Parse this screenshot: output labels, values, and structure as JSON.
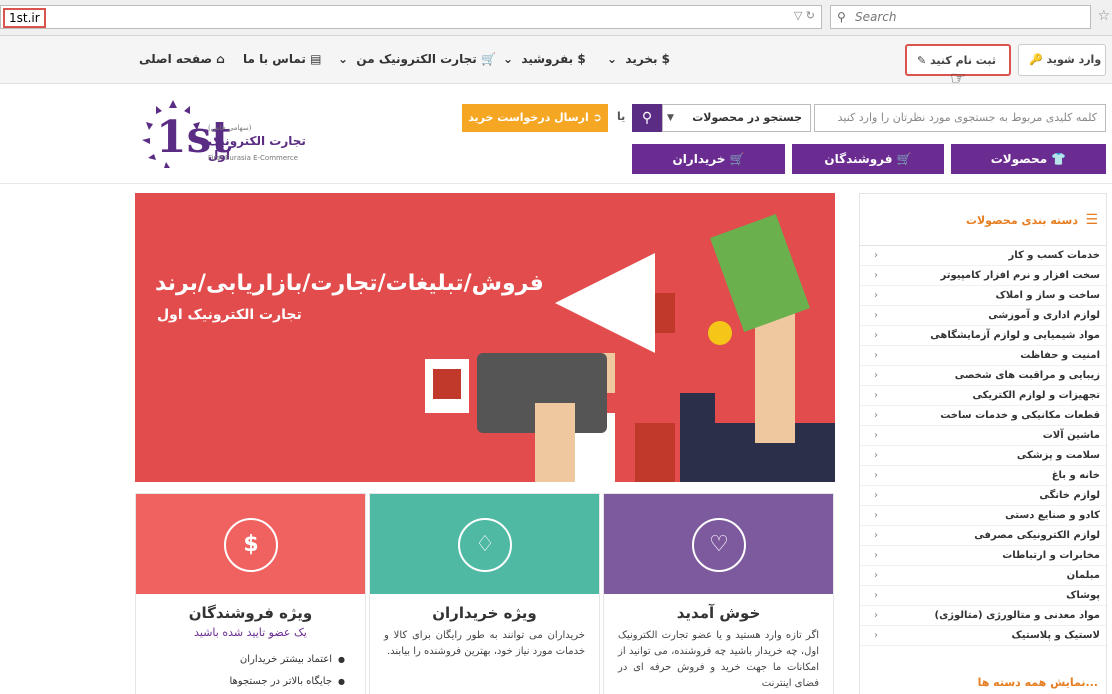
{
  "browser": {
    "url": "1st.ir",
    "search_placeholder": "Search"
  },
  "topnav": {
    "login": "وارد شوید",
    "register": "ثبت نام کنید",
    "home": "صفحه اصلی",
    "contact": "تماس با ما",
    "my_ecommerce": "تجارت الکترونیک من",
    "sell": "بفروشید",
    "buy": "بخرید"
  },
  "header": {
    "logo_number": "1st",
    "logo_fa": "تجارت الکترونیک اول",
    "logo_sub": "(سهامی خاص)",
    "logo_en": "First Eurasia E-Commerce",
    "keyword_placeholder": "کلمه کلیدی مربوط به جستجوی مورد نظرتان را وارد کنید",
    "scope_selected": "جستجو در محصولات",
    "or_label": "یا",
    "request_button": "ارسال درخواست خرید",
    "btn_products": "محصولات",
    "btn_sellers": "فروشندگان",
    "btn_buyers": "خریداران"
  },
  "banner": {
    "title": "فروش/تبلیغات/تجارت/بازاریابی/برند",
    "subtitle": "تجارت الکترونیک اول"
  },
  "cards": {
    "welcome": {
      "title": "خوش آمدید",
      "body": "اگر تازه وارد هستید و یا عضو تجارت الکترونیک اول، چه خریدار باشید چه فروشنده، می توانید از امکانات ما جهت خرید و فروش حرفه ای در فضای اینترنت",
      "color": "#7d5a9e"
    },
    "buyers": {
      "title": "ویژه خریداران",
      "body": "خریداران می توانند به طور رایگان برای کالا و خدمات مورد نیاز خود، بهترین فروشنده را بیابند.",
      "color": "#4fb9a3"
    },
    "sellers": {
      "title": "ویژه فروشندگان",
      "subtitle": "یک عضو تایید شده باشید",
      "item1": "اعتماد بیشتر خریداران",
      "item2": "جایگاه بالاتر در جستجوها",
      "color": "#f0625f"
    }
  },
  "sidebar": {
    "title": "دسته بندی محصولات",
    "items": [
      "خدمات کسب و کار",
      "سخت افزار و نرم افزار کامپیوتر",
      "ساخت و ساز و املاک",
      "لوازم اداری و آموزشی",
      "مواد شیمیایی و لوازم آزمایشگاهی",
      "امنیت و حفاظت",
      "زیبایی و مراقبت های شخصی",
      "تجهیزات و لوازم الکتریکی",
      "قطعات مکانیکی و خدمات ساخت",
      "ماشین آلات",
      "سلامت و پزشکی",
      "خانه و باغ",
      "لوازم خانگی",
      "کادو و صنایع دستی",
      "لوازم الکترونیکی مصرفی",
      "مخابرات و ارتباطات",
      "مبلمان",
      "پوشاک",
      "مواد معدنی و متالورژی (متالوژی)",
      "لاستیک و پلاستیک"
    ],
    "show_all": "نمایش همه دسته ها..."
  }
}
